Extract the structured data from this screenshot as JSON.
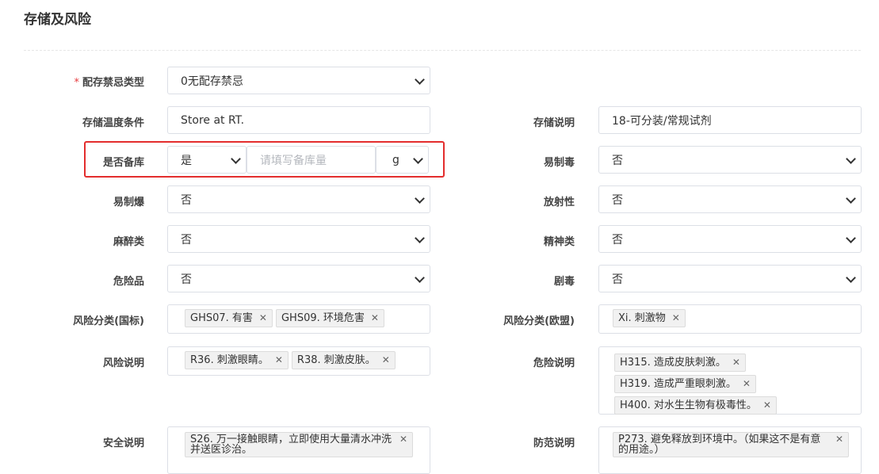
{
  "section": {
    "title": "存储及风险"
  },
  "fields": {
    "storage_forbidden_type": {
      "label": "配存禁忌类型",
      "required_mark": "*",
      "value": "0无配存禁忌"
    },
    "storage_temp": {
      "label": "存储温度条件",
      "value": "Store at RT."
    },
    "storage_desc": {
      "label": "存储说明",
      "value": "18-可分装/常规试剂"
    },
    "backup": {
      "label": "是否备库",
      "value": "是",
      "amount_placeholder": "请填写备库量",
      "unit": "g"
    },
    "easy_poison": {
      "label": "易制毒",
      "value": "否"
    },
    "easy_explosive": {
      "label": "易制爆",
      "value": "否"
    },
    "radioactive": {
      "label": "放射性",
      "value": "否"
    },
    "narcotic": {
      "label": "麻醉类",
      "value": "否"
    },
    "psychotropic": {
      "label": "精神类",
      "value": "否"
    },
    "hazardous": {
      "label": "危险品",
      "value": "否"
    },
    "highly_toxic": {
      "label": "剧毒",
      "value": "否"
    },
    "risk_class_cn": {
      "label": "风险分类(国标)",
      "tags": [
        "GHS07. 有害",
        "GHS09. 环境危害"
      ]
    },
    "risk_class_eu": {
      "label": "风险分类(欧盟)",
      "tags": [
        "Xi. 刺激物"
      ]
    },
    "risk_desc": {
      "label": "风险说明",
      "tags": [
        "R36. 刺激眼睛。",
        "R38. 刺激皮肤。"
      ]
    },
    "hazard_desc": {
      "label": "危险说明",
      "tags": [
        "H315. 造成皮肤刺激。",
        "H319. 造成严重眼刺激。",
        "H400. 对水生生物有极毒性。"
      ]
    },
    "safety_desc": {
      "label": "安全说明",
      "tags": [
        "S26. 万一接触眼睛，立即使用大量清水冲洗并送医诊治。"
      ]
    },
    "precaution_desc": {
      "label": "防范说明",
      "tags": [
        "P273. 避免释放到环境中。（如果这不是有意的用途。）"
      ]
    }
  },
  "tag_remove_glyph": "✕",
  "colors": {
    "highlight": "#e32d2d",
    "required": "#e6393d"
  }
}
